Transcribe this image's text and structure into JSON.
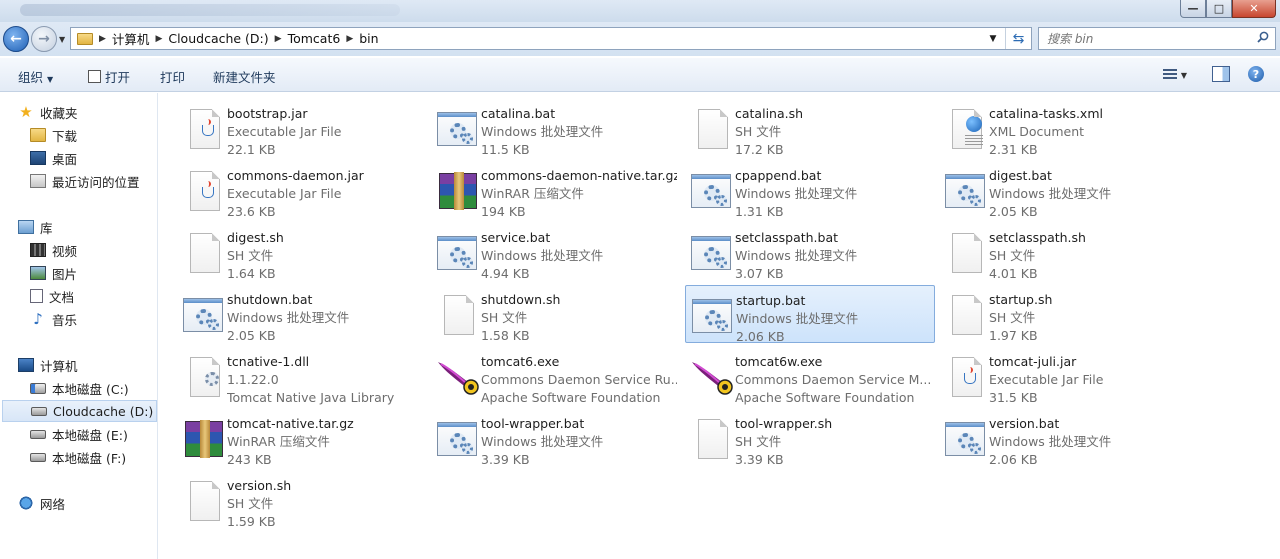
{
  "window": {
    "controls": {
      "minimize": "—",
      "maximize": "□",
      "close": "✕"
    }
  },
  "nav": {
    "back_icon": "back-arrow-icon",
    "forward_icon": "forward-arrow-icon",
    "breadcrumb": [
      "计算机",
      "Cloudcache (D:)",
      "Tomcat6",
      "bin"
    ],
    "search_placeholder": "搜索 bin"
  },
  "toolbar": {
    "organize": "组织",
    "open": "打开",
    "print": "打印",
    "new_folder": "新建文件夹",
    "help": "?"
  },
  "sidebar": {
    "favorites": {
      "label": "收藏夹",
      "items": [
        "下载",
        "桌面",
        "最近访问的位置"
      ]
    },
    "libraries": {
      "label": "库",
      "items": [
        "视频",
        "图片",
        "文档",
        "音乐"
      ]
    },
    "computer": {
      "label": "计算机",
      "items": [
        "本地磁盘 (C:)",
        "Cloudcache (D:)",
        "本地磁盘 (E:)",
        "本地磁盘 (F:)"
      ]
    },
    "network": {
      "label": "网络"
    }
  },
  "files": [
    {
      "name": "bootstrap.jar",
      "type": "Executable Jar File",
      "size": "22.1 KB",
      "icon": "jar"
    },
    {
      "name": "catalina.bat",
      "type": "Windows 批处理文件",
      "size": "11.5 KB",
      "icon": "bat"
    },
    {
      "name": "catalina.sh",
      "type": "SH 文件",
      "size": "17.2 KB",
      "icon": "doc"
    },
    {
      "name": "catalina-tasks.xml",
      "type": "XML Document",
      "size": "2.31 KB",
      "icon": "xml"
    },
    {
      "name": "commons-daemon.jar",
      "type": "Executable Jar File",
      "size": "23.6 KB",
      "icon": "jar"
    },
    {
      "name": "commons-daemon-native.tar.gz",
      "type": "WinRAR 压缩文件",
      "size": "194 KB",
      "icon": "rar"
    },
    {
      "name": "cpappend.bat",
      "type": "Windows 批处理文件",
      "size": "1.31 KB",
      "icon": "bat"
    },
    {
      "name": "digest.bat",
      "type": "Windows 批处理文件",
      "size": "2.05 KB",
      "icon": "bat"
    },
    {
      "name": "digest.sh",
      "type": "SH 文件",
      "size": "1.64 KB",
      "icon": "doc"
    },
    {
      "name": "service.bat",
      "type": "Windows 批处理文件",
      "size": "4.94 KB",
      "icon": "bat"
    },
    {
      "name": "setclasspath.bat",
      "type": "Windows 批处理文件",
      "size": "3.07 KB",
      "icon": "bat"
    },
    {
      "name": "setclasspath.sh",
      "type": "SH 文件",
      "size": "4.01 KB",
      "icon": "doc"
    },
    {
      "name": "shutdown.bat",
      "type": "Windows 批处理文件",
      "size": "2.05 KB",
      "icon": "bat"
    },
    {
      "name": "shutdown.sh",
      "type": "SH 文件",
      "size": "1.58 KB",
      "icon": "doc"
    },
    {
      "name": "startup.bat",
      "type": "Windows 批处理文件",
      "size": "2.06 KB",
      "icon": "bat",
      "selected": true
    },
    {
      "name": "startup.sh",
      "type": "SH 文件",
      "size": "1.97 KB",
      "icon": "doc"
    },
    {
      "name": "tcnative-1.dll",
      "type": "1.1.22.0",
      "size": "Tomcat Native Java Library",
      "icon": "dll"
    },
    {
      "name": "tomcat6.exe",
      "type": "Commons Daemon Service Ru...",
      "size": "Apache Software Foundation",
      "icon": "exe"
    },
    {
      "name": "tomcat6w.exe",
      "type": "Commons Daemon Service M...",
      "size": "Apache Software Foundation",
      "icon": "exe"
    },
    {
      "name": "tomcat-juli.jar",
      "type": "Executable Jar File",
      "size": "31.5 KB",
      "icon": "jar"
    },
    {
      "name": "tomcat-native.tar.gz",
      "type": "WinRAR 压缩文件",
      "size": "243 KB",
      "icon": "rar"
    },
    {
      "name": "tool-wrapper.bat",
      "type": "Windows 批处理文件",
      "size": "3.39 KB",
      "icon": "bat"
    },
    {
      "name": "tool-wrapper.sh",
      "type": "SH 文件",
      "size": "3.39 KB",
      "icon": "doc"
    },
    {
      "name": "version.bat",
      "type": "Windows 批处理文件",
      "size": "2.06 KB",
      "icon": "bat"
    },
    {
      "name": "version.sh",
      "type": "SH 文件",
      "size": "1.59 KB",
      "icon": "doc"
    }
  ]
}
